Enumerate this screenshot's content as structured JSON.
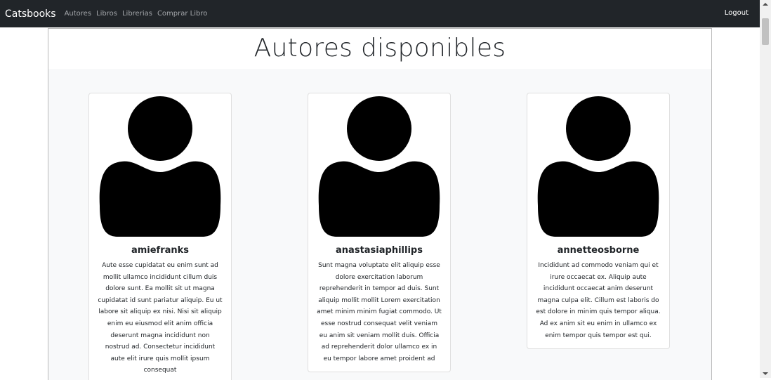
{
  "navbar": {
    "brand": "Catsbooks",
    "links": [
      "Autores",
      "Libros",
      "Librerias",
      "Comprar Libro"
    ],
    "logout": "Logout"
  },
  "page": {
    "title": "Autores disponibles"
  },
  "authors": [
    {
      "name": "amiefranks",
      "bio": "Aute esse cupidatat eu enim sunt ad mollit ullamco incididunt cillum duis dolore sunt. Ea mollit sit ut magna cupidatat id sunt pariatur aliquip. Eu ut labore sit aliquip ex nisi. Nisi sit aliquip enim eu eiusmod elit anim officia deserunt magna incididunt non nostrud ad. Consectetur incididunt aute elit irure quis mollit ipsum consequat"
    },
    {
      "name": "anastasiaphillips",
      "bio": "Sunt magna voluptate elit aliquip esse dolore exercitation laborum reprehenderit in tempor ad duis. Sunt aliquip mollit mollit Lorem exercitation amet minim minim fugiat commodo. Ut esse nostrud consequat velit veniam eu anim sit veniam mollit duis. Officia ad reprehenderit dolor ullamco ex in eu tempor labore amet proident ad"
    },
    {
      "name": "annetteosborne",
      "bio": "Incididunt ad commodo veniam qui et irure occaecat ex. Aliquip aute incididunt occaecat anim deserunt magna culpa elit. Cillum est laboris do est dolore in minim quis tempor aliqua. Ad ex anim sit eu enim in ullamco ex enim tempor quis tempor est qui."
    }
  ],
  "icons": {
    "avatar": "user-avatar-icon"
  },
  "colors": {
    "navbar_bg": "#212529",
    "nav_link": "#a3a6aa",
    "content_bg": "#f8f9fa"
  }
}
